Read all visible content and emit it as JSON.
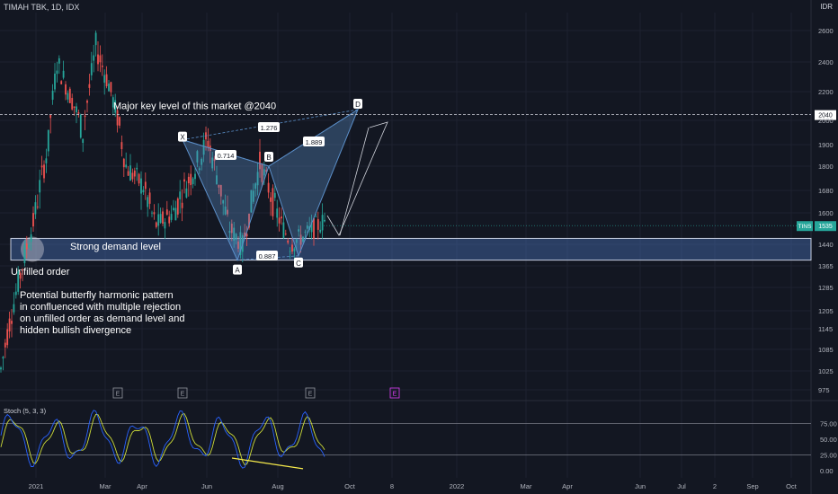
{
  "header": {
    "title": "TIMAH TBK, 1D, IDX",
    "currency": "IDR"
  },
  "chart_data": {
    "type": "candlestick",
    "price_axis": {
      "ticks": [
        "2600",
        "2400",
        "2200",
        "2000",
        "1900",
        "1800",
        "1680",
        "1600",
        "1440",
        "1365",
        "1285",
        "1205",
        "1145",
        "1085",
        "1025",
        "975"
      ]
    },
    "time_axis": {
      "ticks": [
        "2021",
        "Mar",
        "Apr",
        "Jun",
        "Aug",
        "Oct",
        "8",
        "2022",
        "Mar",
        "Apr",
        "Jun",
        "Jul",
        "2",
        "Sep",
        "Oct"
      ]
    },
    "key_level": {
      "value": "2040",
      "label": "Major key level of this market @2040"
    },
    "last_price": {
      "symbol": "TINS",
      "value": "1535"
    },
    "demand_zone": {
      "label": "Strong demand level",
      "note": "Unfilled order"
    },
    "pattern": {
      "points": [
        {
          "name": "X"
        },
        {
          "name": "A"
        },
        {
          "name": "B"
        },
        {
          "name": "C"
        },
        {
          "name": "D"
        }
      ],
      "ratios": [
        "0.714",
        "1.276",
        "1.889",
        "0.887"
      ]
    },
    "description": [
      "Potential butterfly harmonic pattern",
      "in confluenced with multiple rejection",
      "on unfilled order as demand level and",
      "hidden bullish divergence"
    ],
    "earnings_markers": [
      "E",
      "E",
      "E",
      "E"
    ],
    "indicator": {
      "name": "Stoch (5, 3, 3)",
      "ticks": [
        "75.00",
        "50.00",
        "25.00",
        "0.00"
      ]
    },
    "colors": {
      "bull": "#26a69a",
      "bear": "#ef5350",
      "pattern": "#5b8fc9",
      "stoch_k": "#2962ff",
      "stoch_d": "#cddc39",
      "divergence": "#f5e94b",
      "tins_badge": "#26a69a",
      "earnings_future": "#e040fb"
    }
  }
}
